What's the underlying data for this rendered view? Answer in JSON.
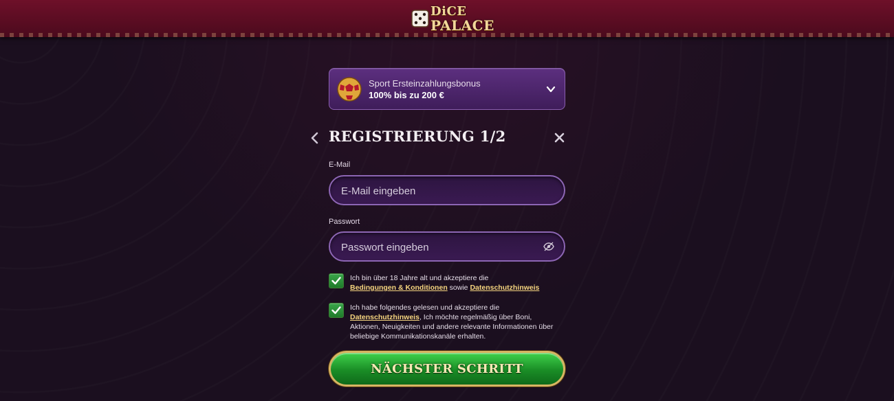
{
  "header": {
    "logo_line1": "DiCE",
    "logo_line2": "PALACE"
  },
  "bonus": {
    "title": "Sport Ersteinzahlungsbonus",
    "amount": "100% bis zu 200 €"
  },
  "registration": {
    "title": "REGISTRIERUNG 1/2",
    "email_label": "E-Mail",
    "email_placeholder": "E-Mail eingeben",
    "email_value": "",
    "password_label": "Passwort",
    "password_placeholder": "Passwort eingeben",
    "password_value": ""
  },
  "consents": [
    {
      "checked": true,
      "text_before": "Ich bin über 18 Jahre alt und akzeptiere die",
      "link1": "Bedingungen & Konditionen",
      "text_middle": "sowie",
      "link2": "Datenschutzhinweis"
    },
    {
      "checked": true,
      "text_before": "Ich habe folgendes gelesen und akzeptiere die",
      "link1": "Datenschutzhinweis",
      "text_after": ", Ich möchte regelmäßig über Boni, Aktionen, Neuigkeiten und andere relevante Informationen über beliebige Kommunikationskanäle erhalten."
    }
  ],
  "next_button": "NÄCHSTER SCHRITT",
  "colors": {
    "header_red": "#6e1029",
    "panel_purple": "#5c2f7f",
    "field_border": "#8d66b5",
    "link_gold": "#f6d57f",
    "button_green": "#1a8d26"
  }
}
